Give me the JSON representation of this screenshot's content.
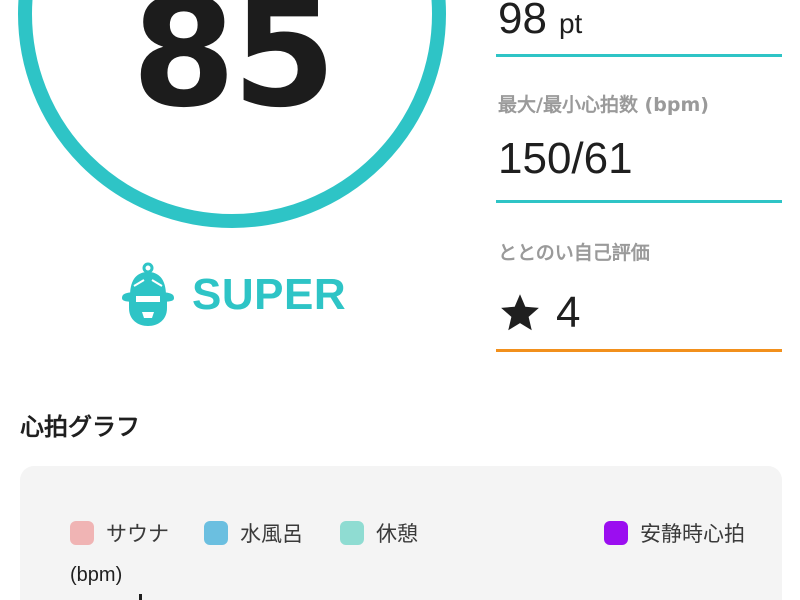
{
  "score": {
    "value": "85"
  },
  "rank": {
    "label": "SUPER",
    "icon": "sauna-hat-face-icon",
    "color": "#2ec4c6"
  },
  "stats": {
    "points": {
      "value": "98",
      "unit": "pt"
    },
    "heart_rate": {
      "label": "最大/最小心拍数 (bpm)",
      "value": "150/61"
    },
    "self_evaluation": {
      "label": "ととのい自己評価",
      "icon": "star-icon",
      "value": "4"
    }
  },
  "graph": {
    "title": "心拍グラフ",
    "legend": [
      {
        "label": "サウナ",
        "color": "#f0b4b4"
      },
      {
        "label": "水風呂",
        "color": "#6bbfe0"
      },
      {
        "label": "休憩",
        "color": "#8fdcd2"
      },
      {
        "label": "安静時心拍",
        "color": "#9b0ef0"
      }
    ],
    "y_axis_unit": "(bpm)"
  },
  "colors": {
    "accent": "#2ec4c6",
    "evaluation_underline": "#f2901c",
    "card_background": "#f4f4f4"
  }
}
